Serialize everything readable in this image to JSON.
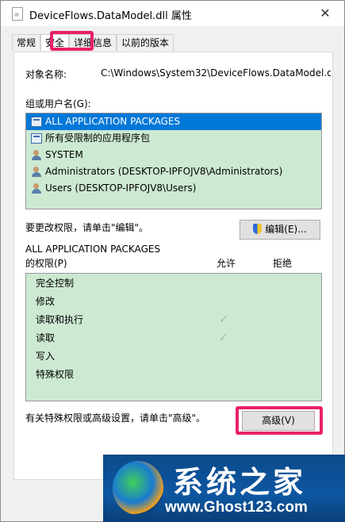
{
  "window": {
    "title": "DeviceFlows.DataModel.dll 属性"
  },
  "tabs": [
    {
      "label": "常规"
    },
    {
      "label": "安全"
    },
    {
      "label": "详细信息"
    },
    {
      "label": "以前的版本"
    }
  ],
  "security": {
    "object_name_label": "对象名称:",
    "object_name_value": "C:\\Windows\\System32\\DeviceFlows.DataModel.d",
    "groups_label": "组或用户名(G):",
    "groups": [
      {
        "name": "ALL APPLICATION PACKAGES",
        "icon": "package-icon",
        "selected": true
      },
      {
        "name": "所有受限制的应用程序包",
        "icon": "package-icon",
        "selected": false
      },
      {
        "name": "SYSTEM",
        "icon": "user-group-icon",
        "selected": false
      },
      {
        "name": "Administrators (DESKTOP-IPFOJV8\\Administrators)",
        "icon": "user-group-icon",
        "selected": false
      },
      {
        "name": "Users (DESKTOP-IPFOJV8\\Users)",
        "icon": "user-group-icon",
        "selected": false
      }
    ],
    "change_hint": "要更改权限，请单击\"编辑\"。",
    "edit_button": "编辑(E)...",
    "perm_for_line1": "ALL APPLICATION PACKAGES",
    "perm_for_line2": "的权限(P)",
    "allow_header": "允许",
    "deny_header": "拒绝",
    "permissions": [
      {
        "name": "完全控制",
        "allow": false
      },
      {
        "name": "修改",
        "allow": false
      },
      {
        "name": "读取和执行",
        "allow": true
      },
      {
        "name": "读取",
        "allow": true
      },
      {
        "name": "写入",
        "allow": false
      },
      {
        "name": "特殊权限",
        "allow": false
      }
    ],
    "advanced_hint": "有关特殊权限或高级设置，请单击\"高级\"。",
    "advanced_button": "高级(V)"
  },
  "watermark": {
    "title": "系统之家",
    "url": "www.Ghost123.com"
  },
  "colors": {
    "highlight": "#e8216a",
    "list_bg": "#cde9d2",
    "selection": "#0078d7"
  }
}
